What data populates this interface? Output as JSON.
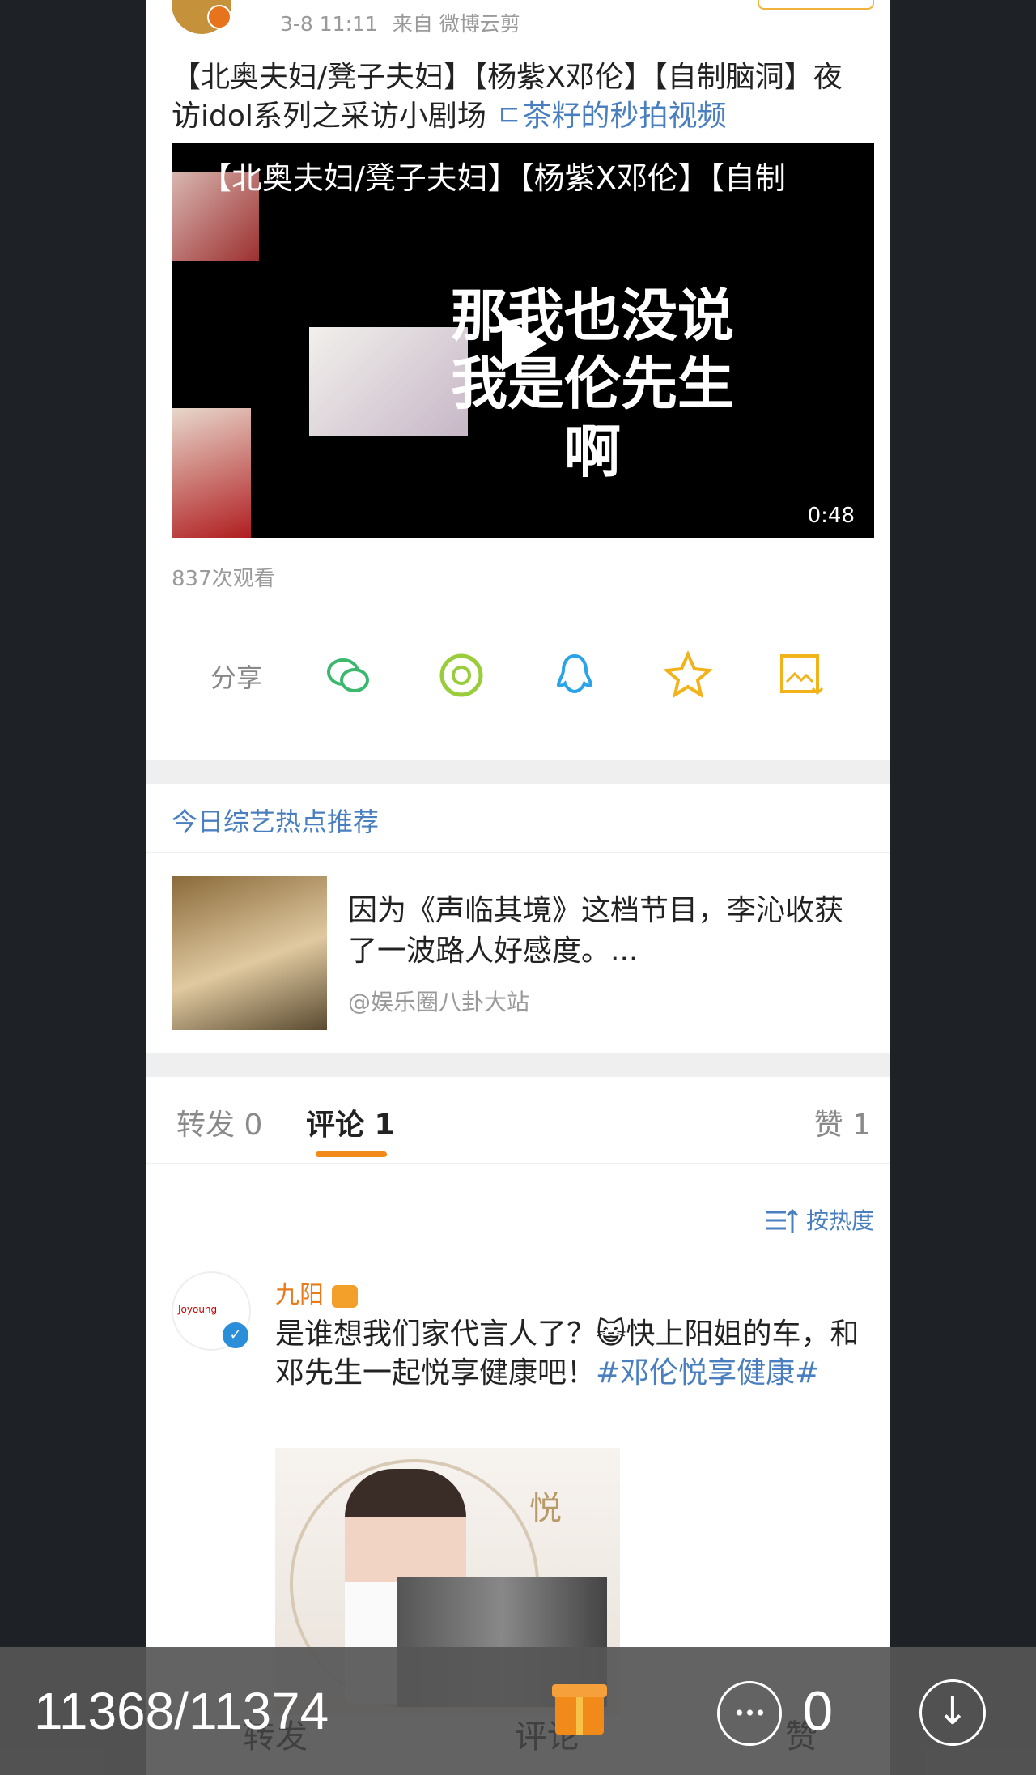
{
  "post": {
    "time": "3-8 11:11",
    "source": "来自 微博云剪",
    "title": "【北奥夫妇/凳子夫妇】【杨紫X邓伦】【自制脑洞】夜访idol系列之采访小剧场",
    "title_link": "ㄷ茶籽的秒拍视频",
    "video": {
      "overlay_title": "【北奥夫妇/凳子夫妇】【杨紫X邓伦】【自制",
      "subtitle_line1": "那我也没说",
      "subtitle_line2": "我是伦先生",
      "subtitle_line3": "啊",
      "duration": "0:48"
    },
    "views": "837次观看"
  },
  "share": {
    "label": "分享",
    "icons": [
      "wechat-icon",
      "moments-icon",
      "qq-icon",
      "favorite-icon",
      "save-image-icon"
    ]
  },
  "recommend": {
    "header": "今日综艺热点推荐",
    "text": "因为《声临其境》这档节目，李沁收获了一波路人好感度。...",
    "source": "@娱乐圈八卦大站"
  },
  "tabs": {
    "repost": "转发 0",
    "comment": "评论 1",
    "like": "赞 1"
  },
  "sort_label": "按热度",
  "comment": {
    "name": "九阳",
    "text": "是谁想我们家代言人了？😺快上阳姐的车，和邓先生一起悦享健康吧！",
    "tag": "#邓伦悦享健康#",
    "image_text": "悦"
  },
  "viewer": {
    "counter": "11368/11374",
    "comment_count": "0",
    "ghost_repost": "转发",
    "ghost_comment": "评论",
    "ghost_like": "赞"
  },
  "colors": {
    "link": "#4a7fbf",
    "accent": "#f28a1a",
    "name": "#e87a1a"
  }
}
